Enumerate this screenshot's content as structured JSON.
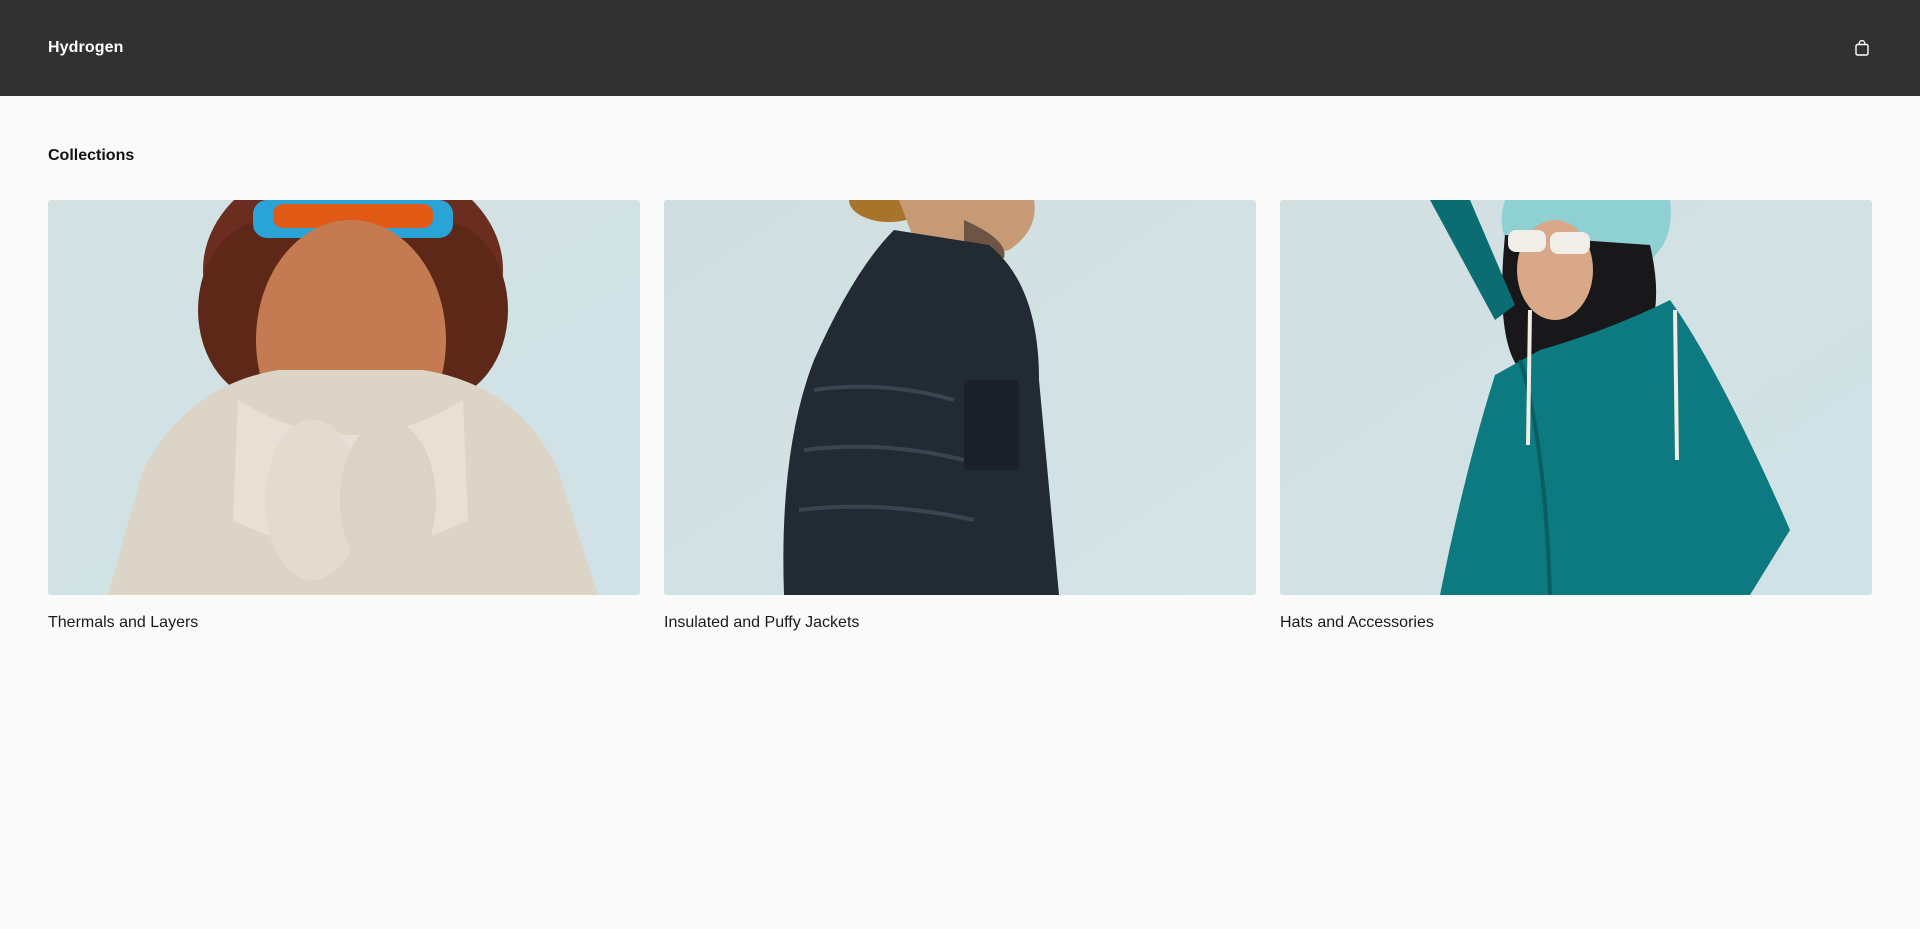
{
  "header": {
    "brand": "Hydrogen",
    "cart_icon": "shopping-bag-icon"
  },
  "main": {
    "title": "Collections",
    "collections": [
      {
        "title": "Thermals and Layers",
        "image": "woman-in-white-winter-jacket-with-ski-goggles-photo"
      },
      {
        "title": "Insulated and Puffy Jackets",
        "image": "man-in-black-puffer-jacket-photo"
      },
      {
        "title": "Hats and Accessories",
        "image": "woman-in-teal-raincoat-and-knit-hat-photo"
      }
    ]
  },
  "colors": {
    "header_bg": "#313131",
    "page_bg": "#fafafa",
    "text": "#111111"
  }
}
